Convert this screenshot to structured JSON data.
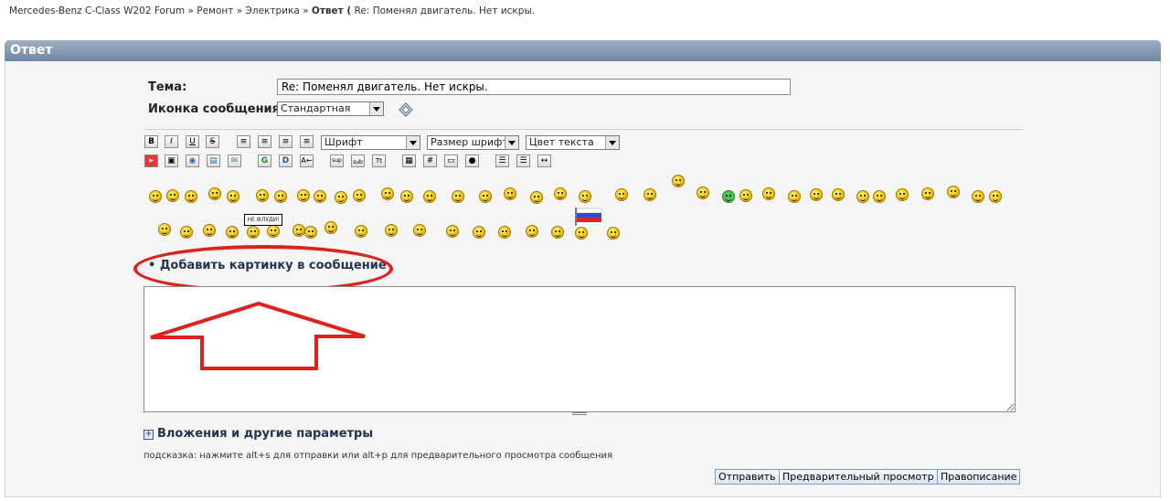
{
  "breadcrumb": {
    "items": [
      "Mercedes-Benz C-Class W202 Forum",
      "Ремонт",
      "Электрика"
    ],
    "separator": "»",
    "current_prefix": "Ответ (",
    "current_title": "Re: Поменял двигатель. Нет искры."
  },
  "panel": {
    "title": "Ответ"
  },
  "form": {
    "subject_label": "Тема:",
    "subject_value": "Re: Поменял двигатель. Нет искры.",
    "icon_label": "Иконка сообщения:",
    "icon_value": "Стандартная"
  },
  "toolbar": {
    "bold": "B",
    "italic": "I",
    "underline": "U",
    "strike": "S",
    "font_select": "Шрифт",
    "size_select": "Размер шрифта",
    "color_select": "Цвет текста",
    "sup": "sup",
    "sub": "sub",
    "tt": "Tt",
    "hash": "#"
  },
  "sign_text": "НЕ ФЛУДИ!",
  "add_image_link": "Добавить картинку в сообщение",
  "attachments_label": "Вложения и другие параметры",
  "hint": "подсказка: нажмите alt+s для отправки или alt+p для предварительного просмотра сообщения",
  "buttons": {
    "submit": "Отправить",
    "preview": "Предварительный просмотр",
    "spellcheck": "Правописание"
  },
  "colors": {
    "annotation": "#e0201a",
    "header": "#7f94b0"
  }
}
